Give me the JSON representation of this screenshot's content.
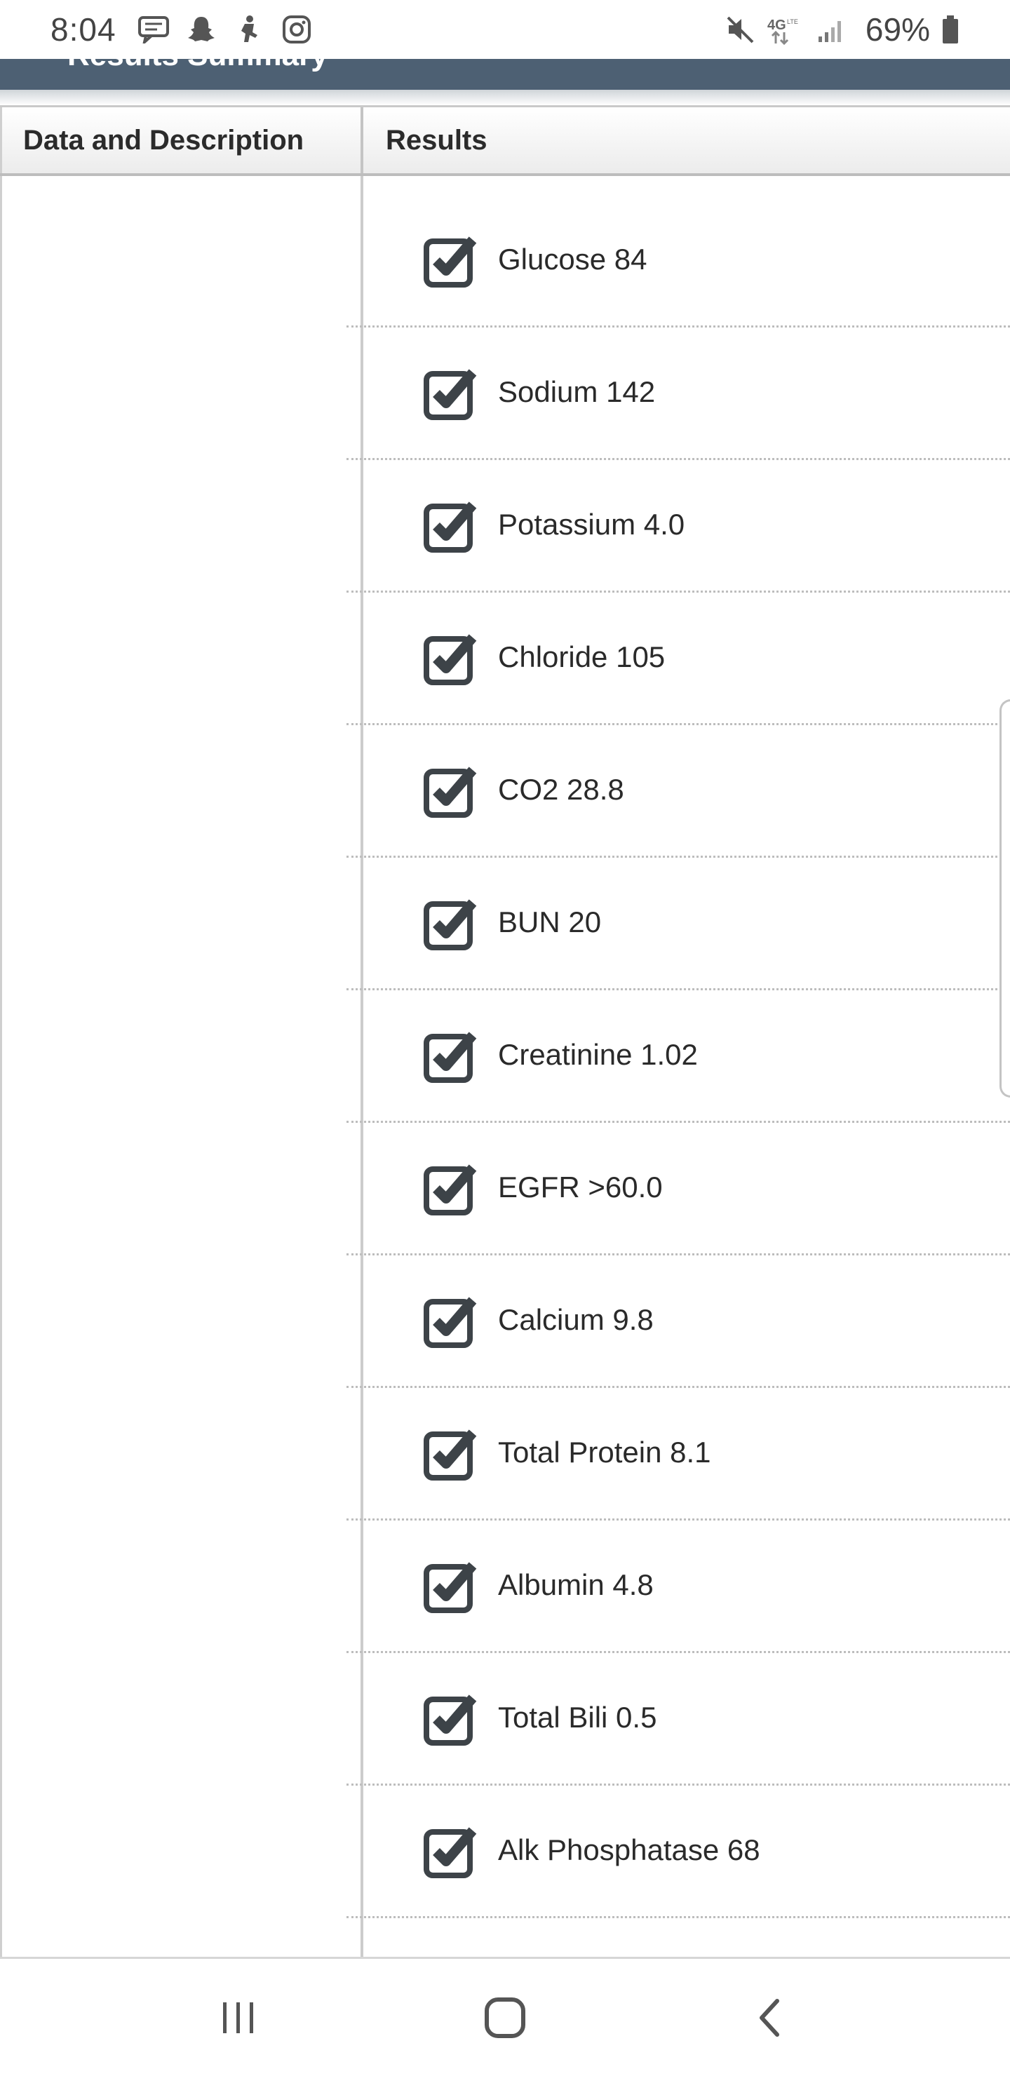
{
  "status_bar": {
    "time": "8:04",
    "battery": "69%",
    "left_icons": [
      "chat-bubble-icon",
      "snapchat-icon",
      "puppet-icon",
      "instagram-icon"
    ],
    "right_icons": [
      "mute-icon",
      "4g-lte-icon",
      "signal-icon",
      "battery-icon"
    ]
  },
  "header": {
    "title": "Results Summary",
    "color": "#4d6073"
  },
  "table": {
    "columns": [
      "Data and Description",
      "Results"
    ],
    "results": [
      {
        "label": "Glucose 84",
        "checked": true
      },
      {
        "label": "Sodium 142",
        "checked": true
      },
      {
        "label": "Potassium 4.0",
        "checked": true
      },
      {
        "label": "Chloride 105",
        "checked": true
      },
      {
        "label": "CO2 28.8",
        "checked": true
      },
      {
        "label": "BUN 20",
        "checked": true
      },
      {
        "label": "Creatinine 1.02",
        "checked": true
      },
      {
        "label": "EGFR >60.0",
        "checked": true
      },
      {
        "label": "Calcium 9.8",
        "checked": true
      },
      {
        "label": "Total Protein 8.1",
        "checked": true
      },
      {
        "label": "Albumin 4.8",
        "checked": true
      },
      {
        "label": "Total Bili 0.5",
        "checked": true
      },
      {
        "label": "Alk Phosphatase 68",
        "checked": true
      }
    ]
  },
  "nav_bar": {
    "buttons": [
      "recent-apps-icon",
      "home-icon",
      "back-icon"
    ]
  }
}
